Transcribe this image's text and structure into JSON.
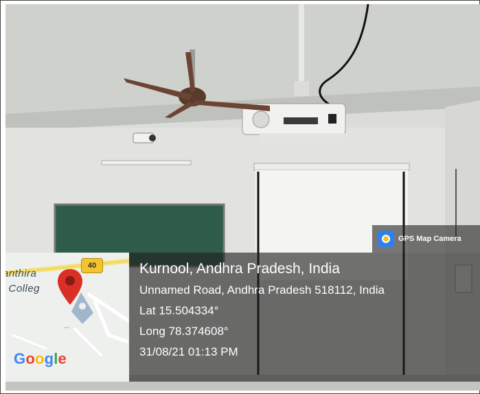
{
  "badge": {
    "icon": "gps-map-camera-icon",
    "text": "GPS Map Camera"
  },
  "map": {
    "road_number": "40",
    "place_line1": "anthira",
    "place_line2": "i Colleg",
    "marker_icon": "map-pin-icon",
    "brand": "Google"
  },
  "location": {
    "city": "Kurnool, Andhra Pradesh, India",
    "address": "Unnamed Road, Andhra Pradesh 518112, India",
    "lat": "Lat 15.504334°",
    "long": "Long 78.374608°",
    "datetime": "31/08/21 01:13 PM"
  },
  "colors": {
    "overlay": "#1e1e1e",
    "pin": "#d93025",
    "road_badge": "#f4c430"
  }
}
